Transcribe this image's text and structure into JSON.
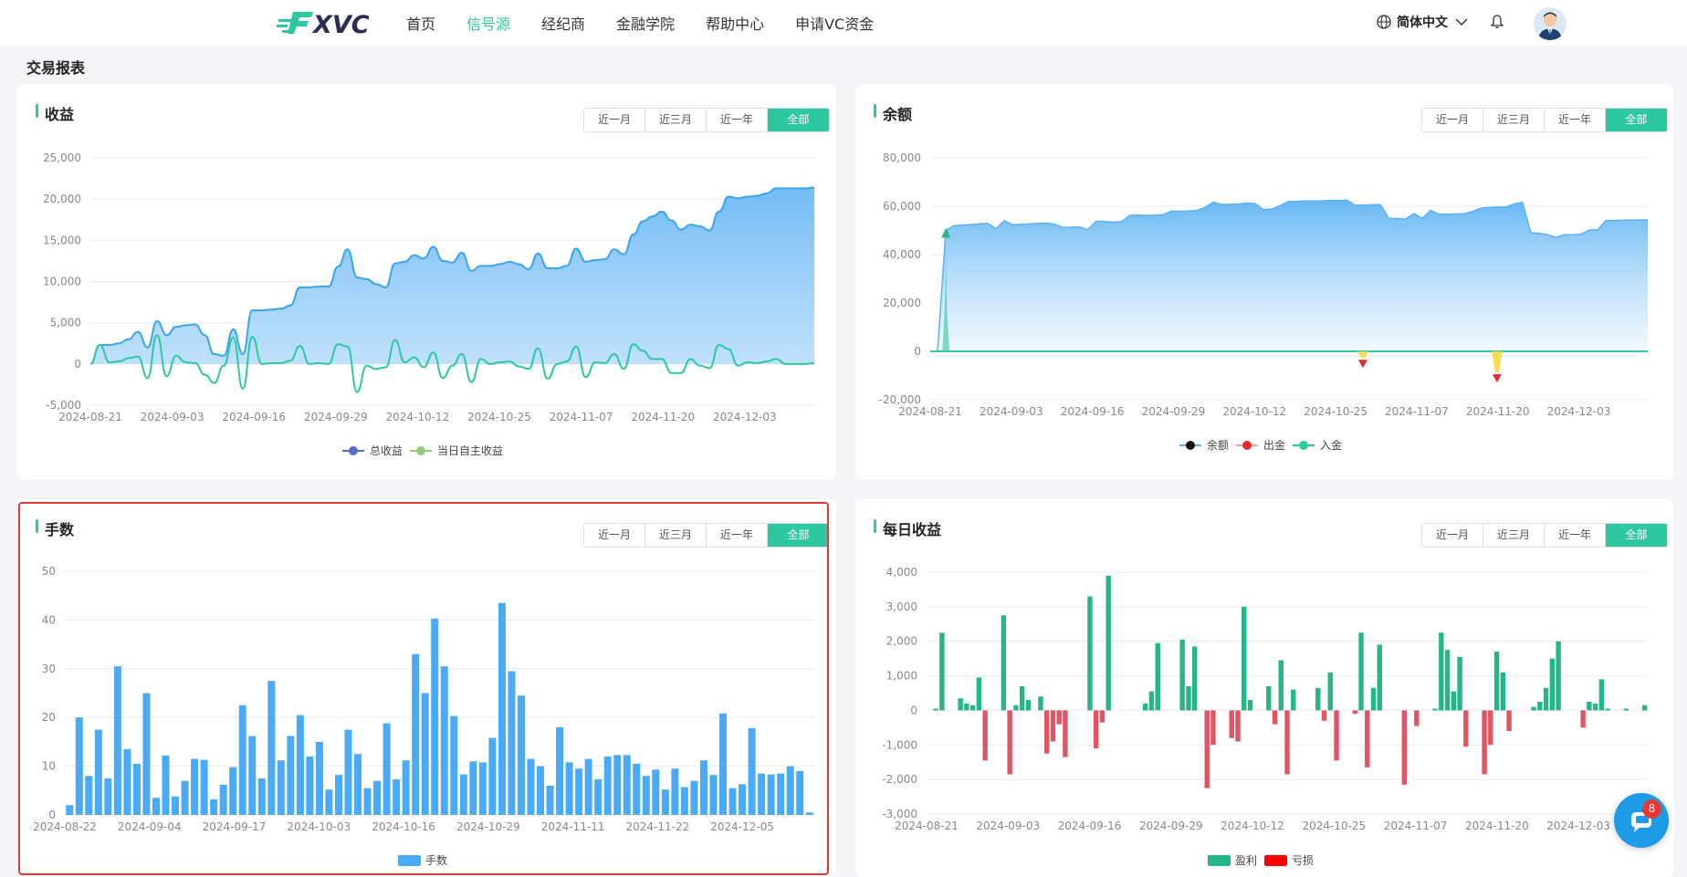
{
  "header": {
    "nav": [
      "首页",
      "信号源",
      "经纪商",
      "金融学院",
      "帮助中心",
      "申请VC资金"
    ],
    "active_nav": 1,
    "language": "简体中文"
  },
  "page_title": "交易报表",
  "range_options": [
    "近一月",
    "近三月",
    "近一年",
    "全部"
  ],
  "chat_badge": "8",
  "colors": {
    "accent": "#2ec8a0",
    "blue": "#4aaaf5",
    "profit": "#26b48a",
    "loss": "#e05563",
    "highlight": "#e53935"
  },
  "chart_data": [
    {
      "id": "profit",
      "type": "area",
      "title": "收益",
      "ylim": [
        -5000,
        25000
      ],
      "yticks": [
        "25,000",
        "20,000",
        "15,000",
        "10,000",
        "5,000",
        "0",
        "-5,000"
      ],
      "xticks": [
        "2024-08-21",
        "2024-09-03",
        "2024-09-16",
        "2024-09-29",
        "2024-10-12",
        "2024-10-25",
        "2024-11-07",
        "2024-11-20",
        "2024-12-03"
      ],
      "legend": [
        "总收益",
        "当日自主收益"
      ],
      "series": [
        {
          "name": "总收益",
          "values": [
            0,
            2300,
            2300,
            2500,
            3000,
            3900,
            2000,
            5200,
            3500,
            4500,
            4700,
            4800,
            3500,
            1200,
            1000,
            4200,
            1200,
            6500,
            6500,
            6600,
            6700,
            7100,
            9300,
            9300,
            9400,
            9400,
            11800,
            13900,
            10500,
            10300,
            9700,
            9300,
            12200,
            12400,
            13200,
            12800,
            14200,
            12500,
            12300,
            13500,
            11300,
            11900,
            11900,
            12100,
            12400,
            12100,
            11500,
            13400,
            11600,
            11600,
            11900,
            14000,
            12400,
            12600,
            12700,
            13900,
            13300,
            15700,
            17300,
            17900,
            18500,
            17400,
            16300,
            16900,
            16700,
            16200,
            18500,
            20300,
            20100,
            20300,
            20400,
            20700,
            21300,
            21300,
            21300,
            21300,
            21400
          ]
        },
        {
          "name": "当日自主收益",
          "values": [
            0,
            2300,
            200,
            300,
            700,
            900,
            -1700,
            3500,
            -1500,
            1000,
            200,
            100,
            -1300,
            -2300,
            -200,
            3200,
            -3000,
            3300,
            0,
            100,
            100,
            400,
            2200,
            0,
            100,
            0,
            2400,
            2100,
            -3400,
            -200,
            -600,
            -400,
            2900,
            200,
            800,
            -400,
            1400,
            -1700,
            -200,
            1200,
            -2200,
            600,
            0,
            200,
            300,
            -300,
            -600,
            1900,
            -1800,
            0,
            300,
            2100,
            -1600,
            200,
            100,
            1200,
            -600,
            2400,
            1600,
            600,
            600,
            -1100,
            -1100,
            600,
            -200,
            -500,
            2300,
            1800,
            -200,
            200,
            100,
            300,
            600,
            0,
            0,
            0,
            100
          ]
        }
      ]
    },
    {
      "id": "balance",
      "type": "area",
      "title": "余额",
      "ylim": [
        -20000,
        80000
      ],
      "yticks": [
        "80,000",
        "60,000",
        "40,000",
        "20,000",
        "0",
        "-20,000"
      ],
      "xticks": [
        "2024-08-21",
        "2024-09-03",
        "2024-09-16",
        "2024-09-29",
        "2024-10-12",
        "2024-10-25",
        "2024-11-07",
        "2024-11-20",
        "2024-12-03"
      ],
      "legend": [
        "余额",
        "出金",
        "入金"
      ],
      "series": [
        {
          "name": "余额",
          "values": [
            0,
            50000,
            52000,
            52200,
            52400,
            52700,
            52900,
            50700,
            54000,
            52300,
            52500,
            52700,
            52900,
            53000,
            52600,
            51200,
            51300,
            51400,
            50300,
            53800,
            53700,
            53400,
            53600,
            56200,
            56300,
            56200,
            56300,
            56500,
            58000,
            57900,
            58000,
            58200,
            59500,
            61700,
            60700,
            60800,
            60900,
            61300,
            61100,
            58600,
            58800,
            60200,
            62000,
            62000,
            62200,
            62100,
            62200,
            62400,
            62300,
            62500,
            60400,
            60500,
            60600,
            60700,
            55000,
            54900,
            54700,
            56900,
            55000,
            58300,
            56700,
            56700,
            56800,
            56900,
            57800,
            59200,
            59500,
            59600,
            59700,
            60900,
            61700,
            49000,
            48800,
            48200,
            47100,
            48200,
            48200,
            48400,
            50200,
            50200,
            54100,
            54100,
            54200,
            54300,
            54300,
            54400
          ]
        },
        {
          "name": "出金",
          "markers": [
            {
              "date": "2024-10-25",
              "value": -5000
            },
            {
              "date": "2024-11-15",
              "value": -11000
            }
          ]
        },
        {
          "name": "入金",
          "markers": [
            {
              "date": "2024-08-22",
              "value": 50000
            }
          ]
        }
      ]
    },
    {
      "id": "lots",
      "type": "bar",
      "title": "手数",
      "ylim": [
        0,
        50
      ],
      "yticks": [
        "50",
        "40",
        "30",
        "20",
        "10",
        "0"
      ],
      "xticks": [
        "2024-08-22",
        "2024-09-04",
        "2024-09-17",
        "2024-10-03",
        "2024-10-16",
        "2024-10-29",
        "2024-11-11",
        "2024-11-22",
        "2024-12-05"
      ],
      "legend": [
        "手数"
      ],
      "series": [
        {
          "name": "手数",
          "values": [
            2,
            20,
            8,
            17.5,
            7.5,
            30.5,
            13.5,
            10.5,
            25,
            3.5,
            12.2,
            3.8,
            7,
            11.5,
            11.3,
            3.2,
            6.2,
            9.8,
            22.5,
            16.2,
            7.5,
            27.5,
            11.2,
            16.2,
            20.5,
            12,
            15,
            5.2,
            8.2,
            17.5,
            12.5,
            5.5,
            7,
            18.8,
            7.3,
            11.2,
            33,
            25,
            40.3,
            30.5,
            20.3,
            8.3,
            11,
            10.8,
            15.8,
            43.5,
            29.5,
            24.5,
            11.5,
            10,
            6,
            18,
            10.8,
            9.5,
            11.5,
            7.3,
            12,
            12.3,
            12.3,
            10.5,
            8,
            9.3,
            5.2,
            9.5,
            5.7,
            7,
            11.2,
            8.2,
            20.8,
            5.5,
            6.3,
            17.8,
            8.5,
            8.3,
            8.5,
            10,
            9,
            0.5
          ]
        }
      ]
    },
    {
      "id": "daily",
      "type": "bar",
      "title": "每日收益",
      "ylim": [
        -3000,
        4000
      ],
      "yticks": [
        "4,000",
        "3,000",
        "2,000",
        "1,000",
        "0",
        "-1,000",
        "-2,000",
        "-3,000"
      ],
      "xticks": [
        "2024-08-21",
        "2024-09-03",
        "2024-09-16",
        "2024-09-29",
        "2024-10-12",
        "2024-10-25",
        "2024-11-07",
        "2024-11-20",
        "2024-12-03"
      ],
      "legend": [
        "盈利",
        "亏损"
      ],
      "series": [
        {
          "name": "每日收益",
          "values": [
            0,
            50,
            2250,
            0,
            0,
            350,
            200,
            150,
            950,
            -1450,
            0,
            0,
            2750,
            -1850,
            150,
            700,
            300,
            0,
            400,
            -1250,
            -900,
            -400,
            -1350,
            0,
            0,
            0,
            3300,
            -1100,
            -350,
            3900,
            0,
            0,
            0,
            0,
            0,
            200,
            550,
            1950,
            0,
            0,
            0,
            2050,
            700,
            1850,
            0,
            -2250,
            -1000,
            0,
            0,
            -800,
            -900,
            3000,
            300,
            0,
            0,
            700,
            -400,
            1450,
            -1850,
            600,
            0,
            0,
            0,
            650,
            -300,
            1100,
            -1450,
            0,
            0,
            -100,
            2250,
            -1650,
            650,
            1900,
            0,
            0,
            0,
            -2150,
            0,
            -450,
            0,
            0,
            50,
            2250,
            1750,
            550,
            1550,
            -1050,
            0,
            0,
            -1850,
            -1000,
            1700,
            1100,
            -600,
            0,
            0,
            0,
            100,
            250,
            650,
            1500,
            2000,
            0,
            0,
            0,
            -500,
            250,
            200,
            900,
            50,
            0,
            0,
            50,
            0,
            0,
            150
          ]
        }
      ]
    }
  ]
}
